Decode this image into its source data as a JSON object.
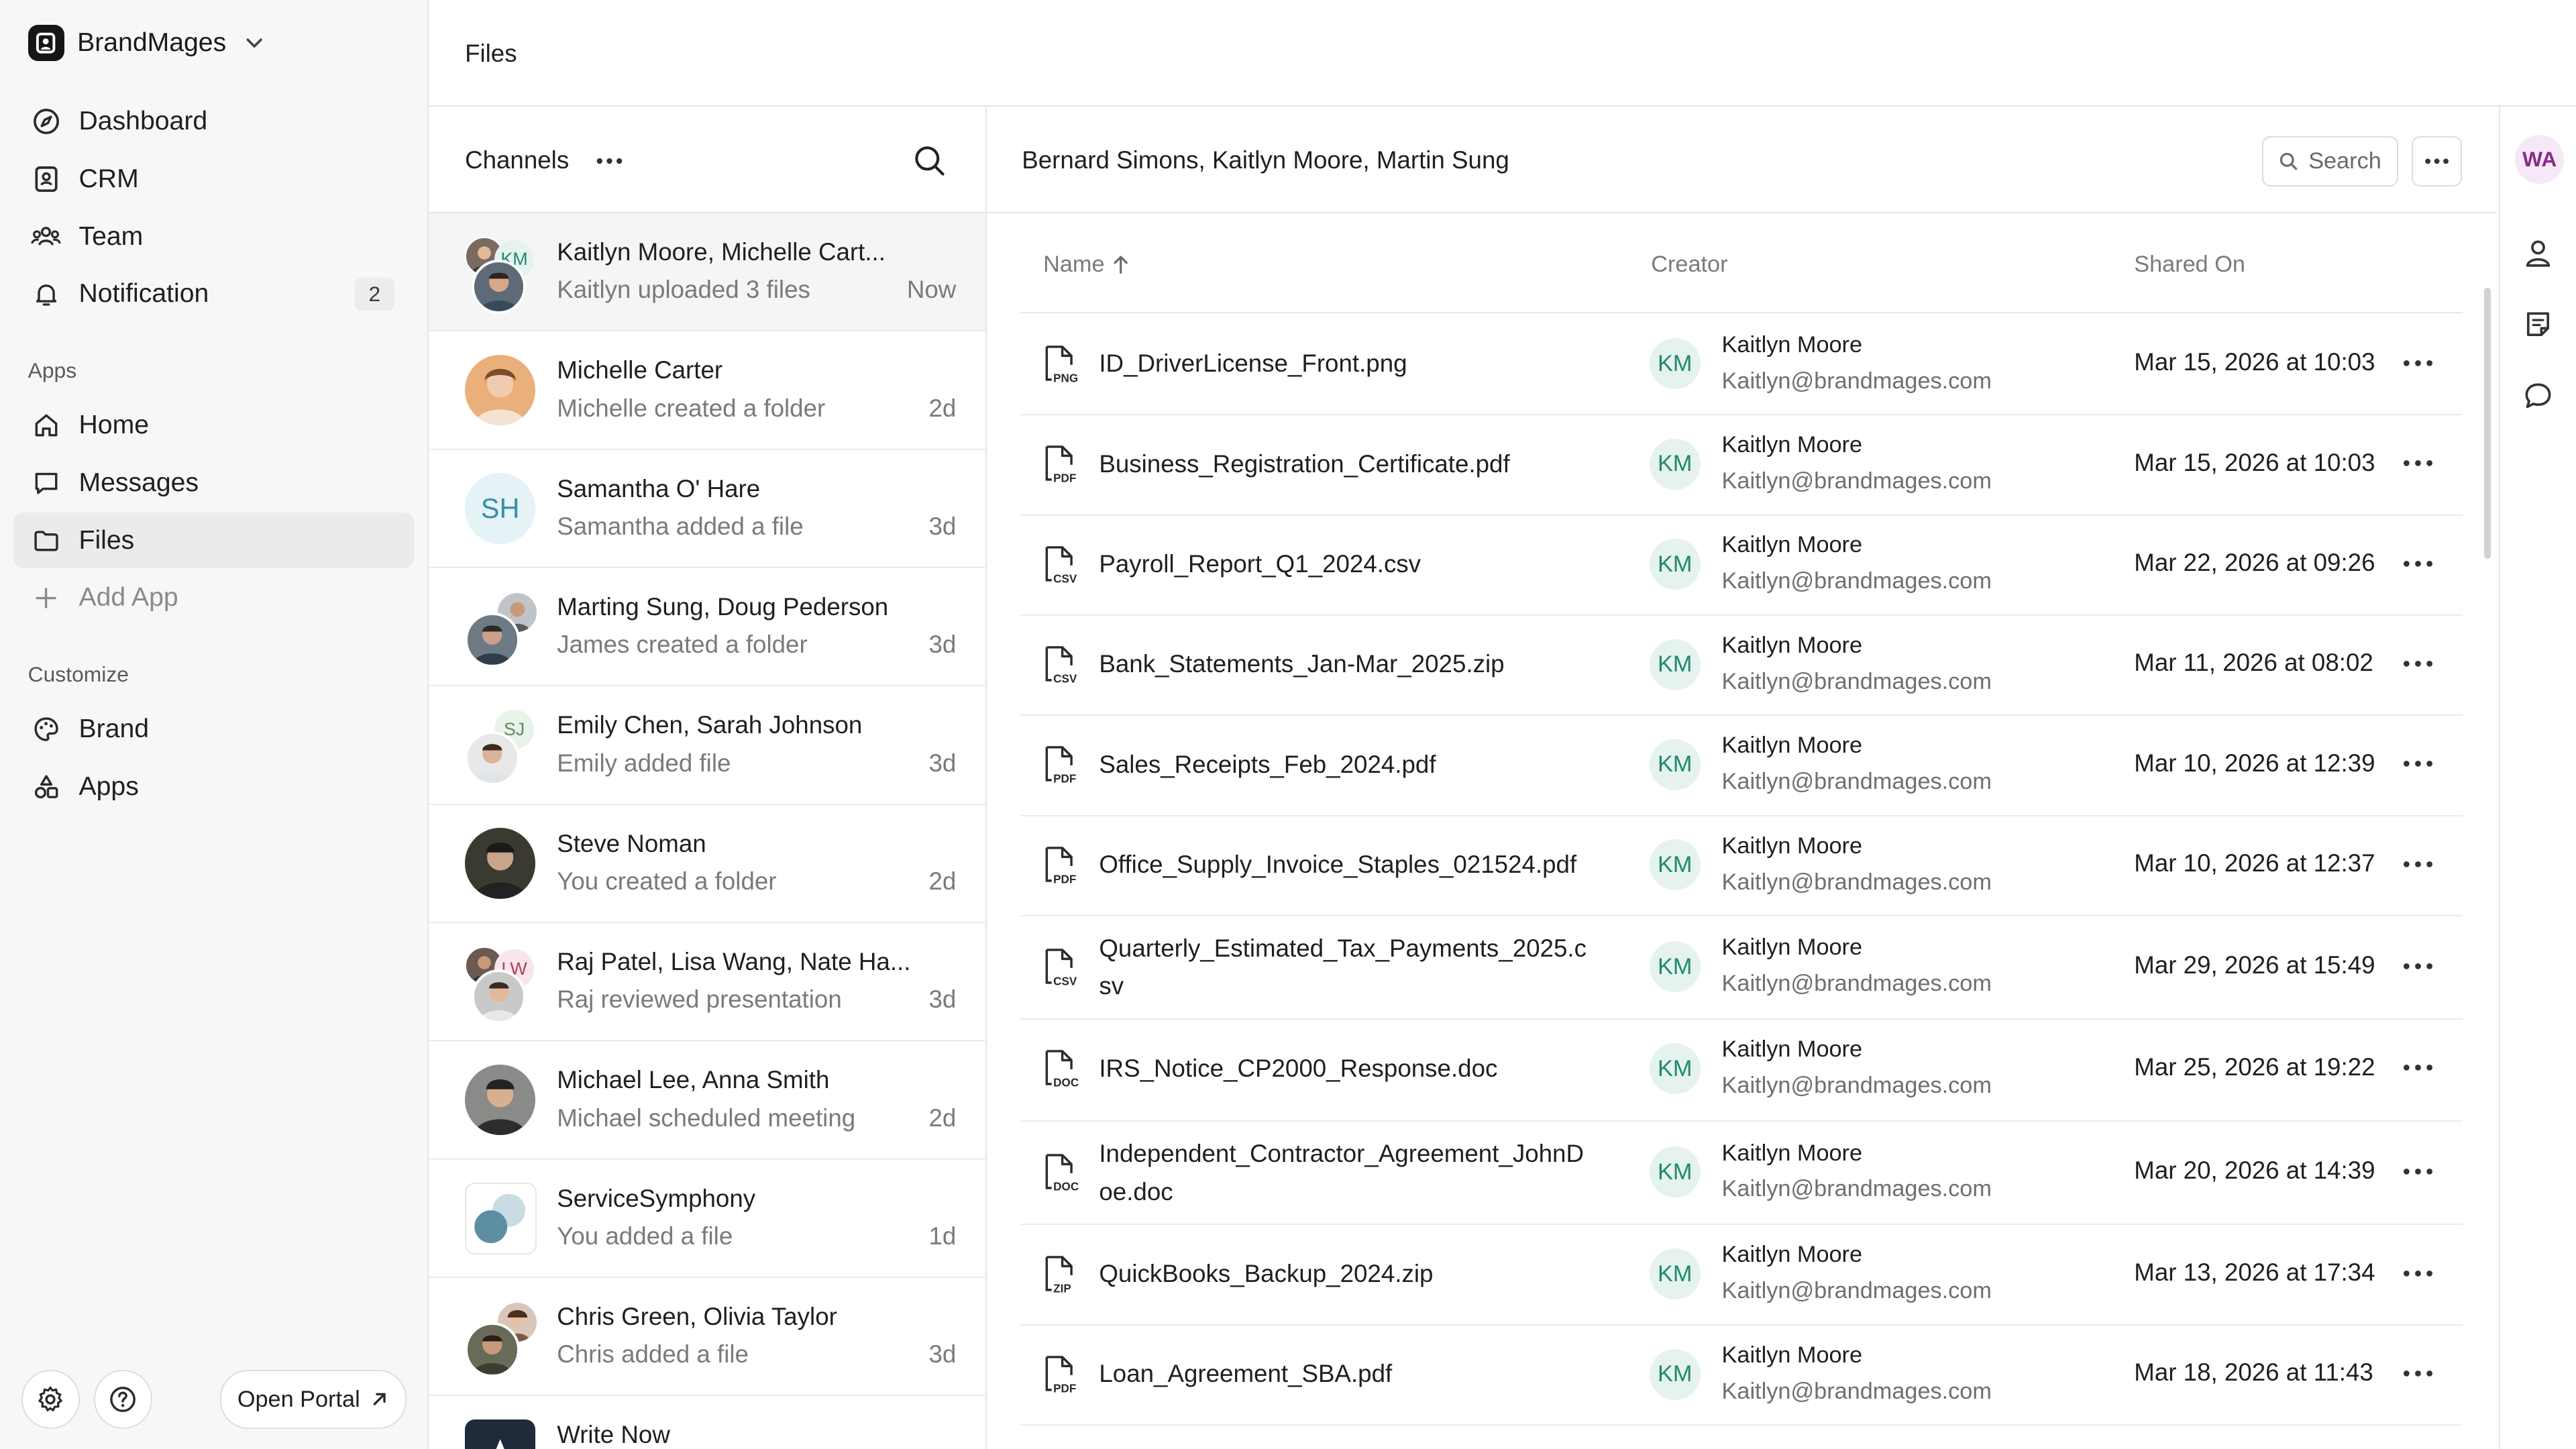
{
  "workspace": {
    "name": "BrandMages"
  },
  "sidebar": {
    "nav": [
      {
        "label": "Dashboard",
        "icon": "compass-icon"
      },
      {
        "label": "CRM",
        "icon": "contact-card-icon"
      },
      {
        "label": "Team",
        "icon": "team-icon"
      },
      {
        "label": "Notification",
        "icon": "bell-icon",
        "badge": "2"
      }
    ],
    "apps_title": "Apps",
    "apps": [
      {
        "label": "Home",
        "icon": "home-icon"
      },
      {
        "label": "Messages",
        "icon": "message-icon"
      },
      {
        "label": "Files",
        "icon": "folder-icon",
        "active": true
      },
      {
        "label": "Add App",
        "icon": "plus-icon"
      }
    ],
    "customize_title": "Customize",
    "customize": [
      {
        "label": "Brand",
        "icon": "palette-icon"
      },
      {
        "label": "Apps",
        "icon": "shapes-icon"
      }
    ],
    "open_portal": "Open Portal"
  },
  "header": {
    "title": "Files"
  },
  "channels": {
    "title": "Channels",
    "items": [
      {
        "name": "Kaitlyn Moore, Michelle Cart...",
        "sub": "Kaitlyn uploaded 3 files",
        "time": "Now",
        "initials": "KM"
      },
      {
        "name": "Michelle Carter",
        "sub": "Michelle created a folder",
        "time": "2d"
      },
      {
        "name": "Samantha O' Hare",
        "sub": "Samantha added a file",
        "time": "3d",
        "initials": "SH"
      },
      {
        "name": "Marting Sung, Doug Pederson",
        "sub": "James created a folder",
        "time": "3d"
      },
      {
        "name": "Emily Chen, Sarah Johnson",
        "sub": "Emily added file",
        "time": "3d",
        "initials": "SJ"
      },
      {
        "name": "Steve Noman",
        "sub": "You created a folder",
        "time": "2d"
      },
      {
        "name": "Raj Patel, Lisa Wang, Nate Ha...",
        "sub": "Raj reviewed presentation",
        "time": "3d",
        "initials": "LW"
      },
      {
        "name": "Michael Lee, Anna Smith",
        "sub": "Michael scheduled meeting",
        "time": "2d"
      },
      {
        "name": "ServiceSymphony",
        "sub": "You added a file",
        "time": "1d"
      },
      {
        "name": "Chris Green, Olivia Taylor",
        "sub": "Chris added a file",
        "time": "3d"
      },
      {
        "name": "Write Now",
        "sub": "",
        "time": ""
      }
    ]
  },
  "main": {
    "title": "Bernard Simons, Kaitlyn Moore, Martin Sung",
    "search_label": "Search",
    "columns": {
      "name": "Name",
      "creator": "Creator",
      "shared": "Shared On"
    },
    "files": [
      {
        "name": "ID_DriverLicense_Front.png",
        "type": "PNG",
        "creator_initials": "KM",
        "creator": "Kaitlyn Moore",
        "email": "Kaitlyn@brandmages.com",
        "shared": "Mar 15, 2026 at 10:03"
      },
      {
        "name": "Business_Registration_Certificate.pdf",
        "type": "PDF",
        "creator_initials": "KM",
        "creator": "Kaitlyn Moore",
        "email": "Kaitlyn@brandmages.com",
        "shared": "Mar 15, 2026 at 10:03"
      },
      {
        "name": "Payroll_Report_Q1_2024.csv",
        "type": "CSV",
        "creator_initials": "KM",
        "creator": "Kaitlyn Moore",
        "email": "Kaitlyn@brandmages.com",
        "shared": "Mar 22, 2026 at 09:26"
      },
      {
        "name": "Bank_Statements_Jan-Mar_2025.zip",
        "type": "CSV",
        "creator_initials": "KM",
        "creator": "Kaitlyn Moore",
        "email": "Kaitlyn@brandmages.com",
        "shared": "Mar 11, 2026 at 08:02"
      },
      {
        "name": "Sales_Receipts_Feb_2024.pdf",
        "type": "PDF",
        "creator_initials": "KM",
        "creator": "Kaitlyn Moore",
        "email": "Kaitlyn@brandmages.com",
        "shared": "Mar 10, 2026 at 12:39"
      },
      {
        "name": "Office_Supply_Invoice_Staples_021524.pdf",
        "type": "PDF",
        "creator_initials": "KM",
        "creator": "Kaitlyn Moore",
        "email": "Kaitlyn@brandmages.com",
        "shared": "Mar 10, 2026 at 12:37"
      },
      {
        "name": "Quarterly_Estimated_Tax_Payments_2025.csv",
        "type": "CSV",
        "creator_initials": "KM",
        "creator": "Kaitlyn Moore",
        "email": "Kaitlyn@brandmages.com",
        "shared": "Mar 29, 2026 at 15:49"
      },
      {
        "name": "IRS_Notice_CP2000_Response.doc",
        "type": "DOC",
        "creator_initials": "KM",
        "creator": "Kaitlyn Moore",
        "email": "Kaitlyn@brandmages.com",
        "shared": "Mar 25, 2026 at 19:22"
      },
      {
        "name": "Independent_Contractor_Agreement_JohnDoe.doc",
        "type": "DOC",
        "creator_initials": "KM",
        "creator": "Kaitlyn Moore",
        "email": "Kaitlyn@brandmages.com",
        "shared": "Mar 20, 2026 at 14:39"
      },
      {
        "name": "QuickBooks_Backup_2024.zip",
        "type": "ZIP",
        "creator_initials": "KM",
        "creator": "Kaitlyn Moore",
        "email": "Kaitlyn@brandmages.com",
        "shared": "Mar 13, 2026 at 17:34"
      },
      {
        "name": "Loan_Agreement_SBA.pdf",
        "type": "PDF",
        "creator_initials": "KM",
        "creator": "Kaitlyn Moore",
        "email": "Kaitlyn@brandmages.com",
        "shared": "Mar 18, 2026 at 11:43"
      }
    ]
  },
  "rail": {
    "avatar": "WA"
  },
  "colors": {
    "accent_green": "#1d8a6e",
    "rail_avatar": "#8a2a8a"
  }
}
